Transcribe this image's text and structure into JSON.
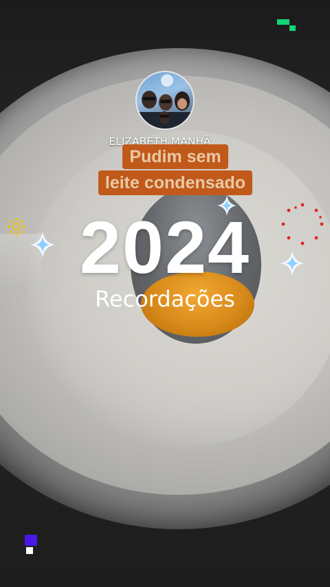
{
  "post": {
    "account_name": "ELIZABETH MANHÃ...",
    "caption_line1": "Pudim sem",
    "caption_line2": "leite condensado",
    "year": "2024",
    "subtitle": "Recordações"
  },
  "icons": {
    "avatar": "profile-photo",
    "sparkles": "sparkle-icon",
    "sun": "sun-icon",
    "firework": "firework-icon"
  },
  "colors": {
    "caption_bg": "#c1591a",
    "caption_text": "#e8c9a5",
    "green_accent": "#12d675",
    "blue_accent": "#4a18e6"
  }
}
